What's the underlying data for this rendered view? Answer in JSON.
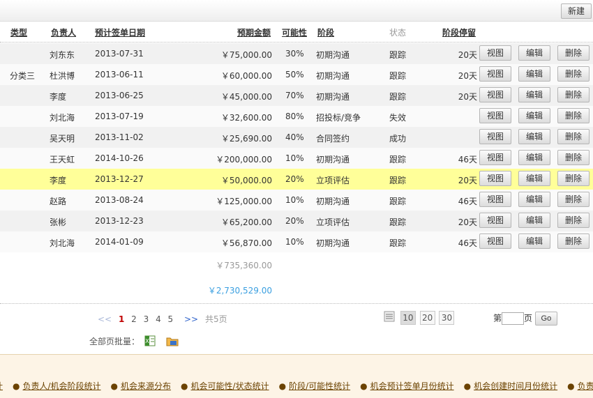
{
  "toolbar": {
    "new_label": "新建"
  },
  "columns": {
    "type": "类型",
    "owner": "负责人",
    "sign_date": "预计签单日期",
    "amount": "预期金额",
    "probability": "可能性",
    "stage": "阶段",
    "status": "状态",
    "stage_stay": "阶段停留"
  },
  "row_actions": {
    "view": "视图",
    "edit": "编辑",
    "delete": "删除"
  },
  "rows": [
    {
      "type": "",
      "owner": "刘东东",
      "date": "2013-07-31",
      "amount": "￥75,000.00",
      "prob": "30%",
      "stage": "初期沟通",
      "status": "跟踪",
      "stay": "20天"
    },
    {
      "type": "分类三",
      "owner": "杜洪博",
      "date": "2013-06-11",
      "amount": "￥60,000.00",
      "prob": "50%",
      "stage": "初期沟通",
      "status": "跟踪",
      "stay": "20天"
    },
    {
      "type": "",
      "owner": "李度",
      "date": "2013-06-25",
      "amount": "￥45,000.00",
      "prob": "70%",
      "stage": "初期沟通",
      "status": "跟踪",
      "stay": "20天"
    },
    {
      "type": "",
      "owner": "刘北海",
      "date": "2013-07-19",
      "amount": "￥32,600.00",
      "prob": "80%",
      "stage": "招投标/竞争",
      "status": "失效",
      "stay": ""
    },
    {
      "type": "",
      "owner": "吴天明",
      "date": "2013-11-02",
      "amount": "￥25,690.00",
      "prob": "40%",
      "stage": "合同签约",
      "status": "成功",
      "stay": ""
    },
    {
      "type": "",
      "owner": "王天虹",
      "date": "2014-10-26",
      "amount": "￥200,000.00",
      "prob": "10%",
      "stage": "初期沟通",
      "status": "跟踪",
      "stay": "46天"
    },
    {
      "type": "",
      "owner": "李度",
      "date": "2013-12-27",
      "amount": "￥50,000.00",
      "prob": "20%",
      "stage": "立项评估",
      "status": "跟踪",
      "stay": "20天"
    },
    {
      "type": "",
      "owner": "赵路",
      "date": "2013-08-24",
      "amount": "￥125,000.00",
      "prob": "10%",
      "stage": "初期沟通",
      "status": "跟踪",
      "stay": "46天"
    },
    {
      "type": "",
      "owner": "张彬",
      "date": "2013-12-23",
      "amount": "￥65,200.00",
      "prob": "20%",
      "stage": "立项评估",
      "status": "跟踪",
      "stay": "20天"
    },
    {
      "type": "",
      "owner": "刘北海",
      "date": "2014-01-09",
      "amount": "￥56,870.00",
      "prob": "10%",
      "stage": "初期沟通",
      "status": "跟踪",
      "stay": "46天"
    }
  ],
  "highlight_row": 6,
  "totals": {
    "page_total": "￥735,360.00",
    "grand_total": "￥2,730,529.00"
  },
  "pager": {
    "prev": "<<",
    "pages": [
      "1",
      "2",
      "3",
      "4",
      "5"
    ],
    "current": "1",
    "next": ">>",
    "total_pages": "共5页",
    "sizes": [
      "10",
      "20",
      "30"
    ],
    "active_size": "10",
    "goto_prefix": "第",
    "goto_suffix": "页",
    "go_label": "Go"
  },
  "batch": {
    "label": "全部页批量：",
    "icons": [
      "excel-export-icon",
      "folder-export-icon"
    ]
  },
  "footer_links": [
    "计",
    "负责人/机会阶段统计",
    "机会来源分布",
    "机会可能性/状态统计",
    "阶段/可能性统计",
    "机会预计签单月份统计",
    "机会创建时间月份统计",
    "负责"
  ],
  "colors": {
    "highlight": "#ffff99",
    "current_page": "#c00000",
    "grand_total": "#3a9fe0",
    "footer_bg": "#fdf4e6"
  }
}
